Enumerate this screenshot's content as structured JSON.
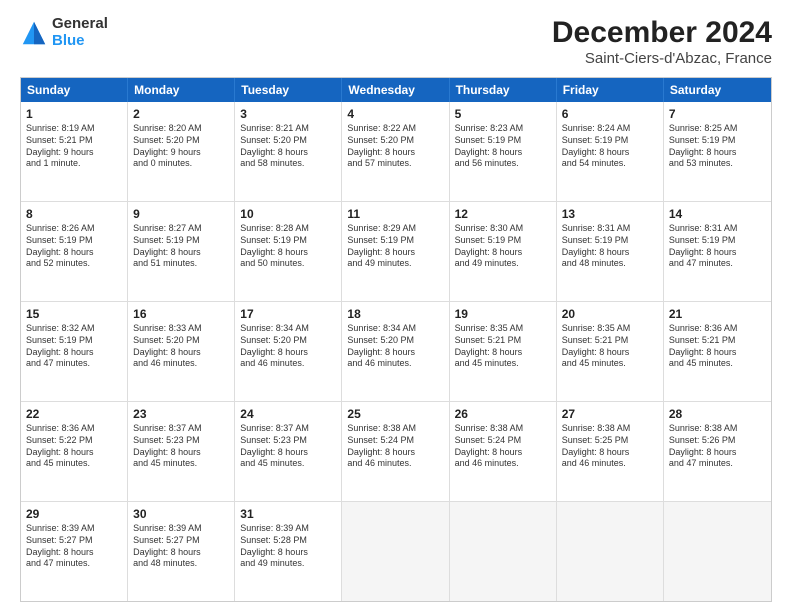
{
  "header": {
    "logo_general": "General",
    "logo_blue": "Blue",
    "month_title": "December 2024",
    "location": "Saint-Ciers-d'Abzac, France"
  },
  "days_of_week": [
    "Sunday",
    "Monday",
    "Tuesday",
    "Wednesday",
    "Thursday",
    "Friday",
    "Saturday"
  ],
  "rows": [
    [
      {
        "day": "1",
        "info": "Sunrise: 8:19 AM\nSunset: 5:21 PM\nDaylight: 9 hours\nand 1 minute."
      },
      {
        "day": "2",
        "info": "Sunrise: 8:20 AM\nSunset: 5:20 PM\nDaylight: 9 hours\nand 0 minutes."
      },
      {
        "day": "3",
        "info": "Sunrise: 8:21 AM\nSunset: 5:20 PM\nDaylight: 8 hours\nand 58 minutes."
      },
      {
        "day": "4",
        "info": "Sunrise: 8:22 AM\nSunset: 5:20 PM\nDaylight: 8 hours\nand 57 minutes."
      },
      {
        "day": "5",
        "info": "Sunrise: 8:23 AM\nSunset: 5:19 PM\nDaylight: 8 hours\nand 56 minutes."
      },
      {
        "day": "6",
        "info": "Sunrise: 8:24 AM\nSunset: 5:19 PM\nDaylight: 8 hours\nand 54 minutes."
      },
      {
        "day": "7",
        "info": "Sunrise: 8:25 AM\nSunset: 5:19 PM\nDaylight: 8 hours\nand 53 minutes."
      }
    ],
    [
      {
        "day": "8",
        "info": "Sunrise: 8:26 AM\nSunset: 5:19 PM\nDaylight: 8 hours\nand 52 minutes."
      },
      {
        "day": "9",
        "info": "Sunrise: 8:27 AM\nSunset: 5:19 PM\nDaylight: 8 hours\nand 51 minutes."
      },
      {
        "day": "10",
        "info": "Sunrise: 8:28 AM\nSunset: 5:19 PM\nDaylight: 8 hours\nand 50 minutes."
      },
      {
        "day": "11",
        "info": "Sunrise: 8:29 AM\nSunset: 5:19 PM\nDaylight: 8 hours\nand 49 minutes."
      },
      {
        "day": "12",
        "info": "Sunrise: 8:30 AM\nSunset: 5:19 PM\nDaylight: 8 hours\nand 49 minutes."
      },
      {
        "day": "13",
        "info": "Sunrise: 8:31 AM\nSunset: 5:19 PM\nDaylight: 8 hours\nand 48 minutes."
      },
      {
        "day": "14",
        "info": "Sunrise: 8:31 AM\nSunset: 5:19 PM\nDaylight: 8 hours\nand 47 minutes."
      }
    ],
    [
      {
        "day": "15",
        "info": "Sunrise: 8:32 AM\nSunset: 5:19 PM\nDaylight: 8 hours\nand 47 minutes."
      },
      {
        "day": "16",
        "info": "Sunrise: 8:33 AM\nSunset: 5:20 PM\nDaylight: 8 hours\nand 46 minutes."
      },
      {
        "day": "17",
        "info": "Sunrise: 8:34 AM\nSunset: 5:20 PM\nDaylight: 8 hours\nand 46 minutes."
      },
      {
        "day": "18",
        "info": "Sunrise: 8:34 AM\nSunset: 5:20 PM\nDaylight: 8 hours\nand 46 minutes."
      },
      {
        "day": "19",
        "info": "Sunrise: 8:35 AM\nSunset: 5:21 PM\nDaylight: 8 hours\nand 45 minutes."
      },
      {
        "day": "20",
        "info": "Sunrise: 8:35 AM\nSunset: 5:21 PM\nDaylight: 8 hours\nand 45 minutes."
      },
      {
        "day": "21",
        "info": "Sunrise: 8:36 AM\nSunset: 5:21 PM\nDaylight: 8 hours\nand 45 minutes."
      }
    ],
    [
      {
        "day": "22",
        "info": "Sunrise: 8:36 AM\nSunset: 5:22 PM\nDaylight: 8 hours\nand 45 minutes."
      },
      {
        "day": "23",
        "info": "Sunrise: 8:37 AM\nSunset: 5:23 PM\nDaylight: 8 hours\nand 45 minutes."
      },
      {
        "day": "24",
        "info": "Sunrise: 8:37 AM\nSunset: 5:23 PM\nDaylight: 8 hours\nand 45 minutes."
      },
      {
        "day": "25",
        "info": "Sunrise: 8:38 AM\nSunset: 5:24 PM\nDaylight: 8 hours\nand 46 minutes."
      },
      {
        "day": "26",
        "info": "Sunrise: 8:38 AM\nSunset: 5:24 PM\nDaylight: 8 hours\nand 46 minutes."
      },
      {
        "day": "27",
        "info": "Sunrise: 8:38 AM\nSunset: 5:25 PM\nDaylight: 8 hours\nand 46 minutes."
      },
      {
        "day": "28",
        "info": "Sunrise: 8:38 AM\nSunset: 5:26 PM\nDaylight: 8 hours\nand 47 minutes."
      }
    ],
    [
      {
        "day": "29",
        "info": "Sunrise: 8:39 AM\nSunset: 5:27 PM\nDaylight: 8 hours\nand 47 minutes."
      },
      {
        "day": "30",
        "info": "Sunrise: 8:39 AM\nSunset: 5:27 PM\nDaylight: 8 hours\nand 48 minutes."
      },
      {
        "day": "31",
        "info": "Sunrise: 8:39 AM\nSunset: 5:28 PM\nDaylight: 8 hours\nand 49 minutes."
      },
      {
        "day": "",
        "info": ""
      },
      {
        "day": "",
        "info": ""
      },
      {
        "day": "",
        "info": ""
      },
      {
        "day": "",
        "info": ""
      }
    ]
  ]
}
